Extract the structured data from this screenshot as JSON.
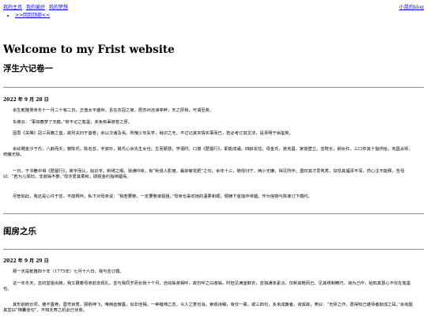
{
  "nav": {
    "home": "我的主页",
    "hobby": "我的爱好",
    "dream": "我的梦想",
    "user": "小晁的blog",
    "back": ">>回到顶部<<"
  },
  "title": "Welcome to my Frist website",
  "section1": {
    "heading": "浮生六记卷一",
    "date": "2022 年 9 月 28 日",
    "paragraphs": [
      "余生乾隆癸未冬十一月二十有二日，正值太平盛世，且在衣冠之家，居苏州沧浪亭畔，天之厚我，可谓至矣。",
      "东坡云：“事如春梦了无痕。”苟不记之笔墨，未免有辜彼苍之厚。",
      "因思《关雎》冠三百篇之首，故列夫妇于首卷；余以次递及焉。所愧少年失学，稍识之无，不过记其实情实事而已，若必考订其文法，是责明于垢鉴矣。",
      "余幼聘金沙于氏，八龄而夭；娶陈氏。陈名芸，字淑珍，舅氏心余先生女也。生而颖慧，学语时，口授《琵琶行》，即能成诵。四龄失怙，母金氏，弟克昌，家徒壁立。芸既长，娴女红，三口仰其十指供给，克昌从师，修脯无缺。",
      "一日，于书簏中得《琵琶行》，挨字而认，始识字。刺绣之暇，渐通吟咏，有“秋侵人影瘦，霜染菊花肥”之句。余年十三，随母归宁，两小无嫌，得见所作，虽叹其才思隽秀，窃恐其福泽不深，然心注不能释，告母曰：“若为儿择妇，非淑姊不娶。”母亦爱其柔和，即脱金约指缔姻焉。",
      "尽管如此，我还是心许于芸，不能释怀。私下对母亲说：“我若要娶，一定要娶淑姐姐。”母亲也喜欢她的温柔和顺，便摘下金指环缔姻，作为信物与陈家订下婚约。"
    ]
  },
  "section2": {
    "heading": "闺房之乐",
    "date": "2022 年 9 月 29 日",
    "paragraphs": [
      "那一天是乾隆四十年（1775年）七月十六日，我与芸订婚。",
      "这一年冬天，芸的堂姐出嫁，我又跟着母亲前去观礼。芸与我同岁而长我十个月，自幼姊弟相呼，故仍呼之曰淑姊。时但见满室鲜衣，芸独通体素淡，仅新其鞋而已。见其绣制精巧，询为己作，始知其慧心不仅在笔墨也。",
      "其形削肩长项，瘦不露骨，眉弯目秀，顾盼神飞，唯两齿微露，似非佳相。一种缠绵之态，令人之意也消。索观诗稿，有仅一联，或三四句，多未成篇者。询其故，笑曰：“无师之作，愿得知己堪师者敲成之耳。”余戏题其签曰“锦囊佳句”，不知夭寿之机此已伏矣。"
    ]
  }
}
